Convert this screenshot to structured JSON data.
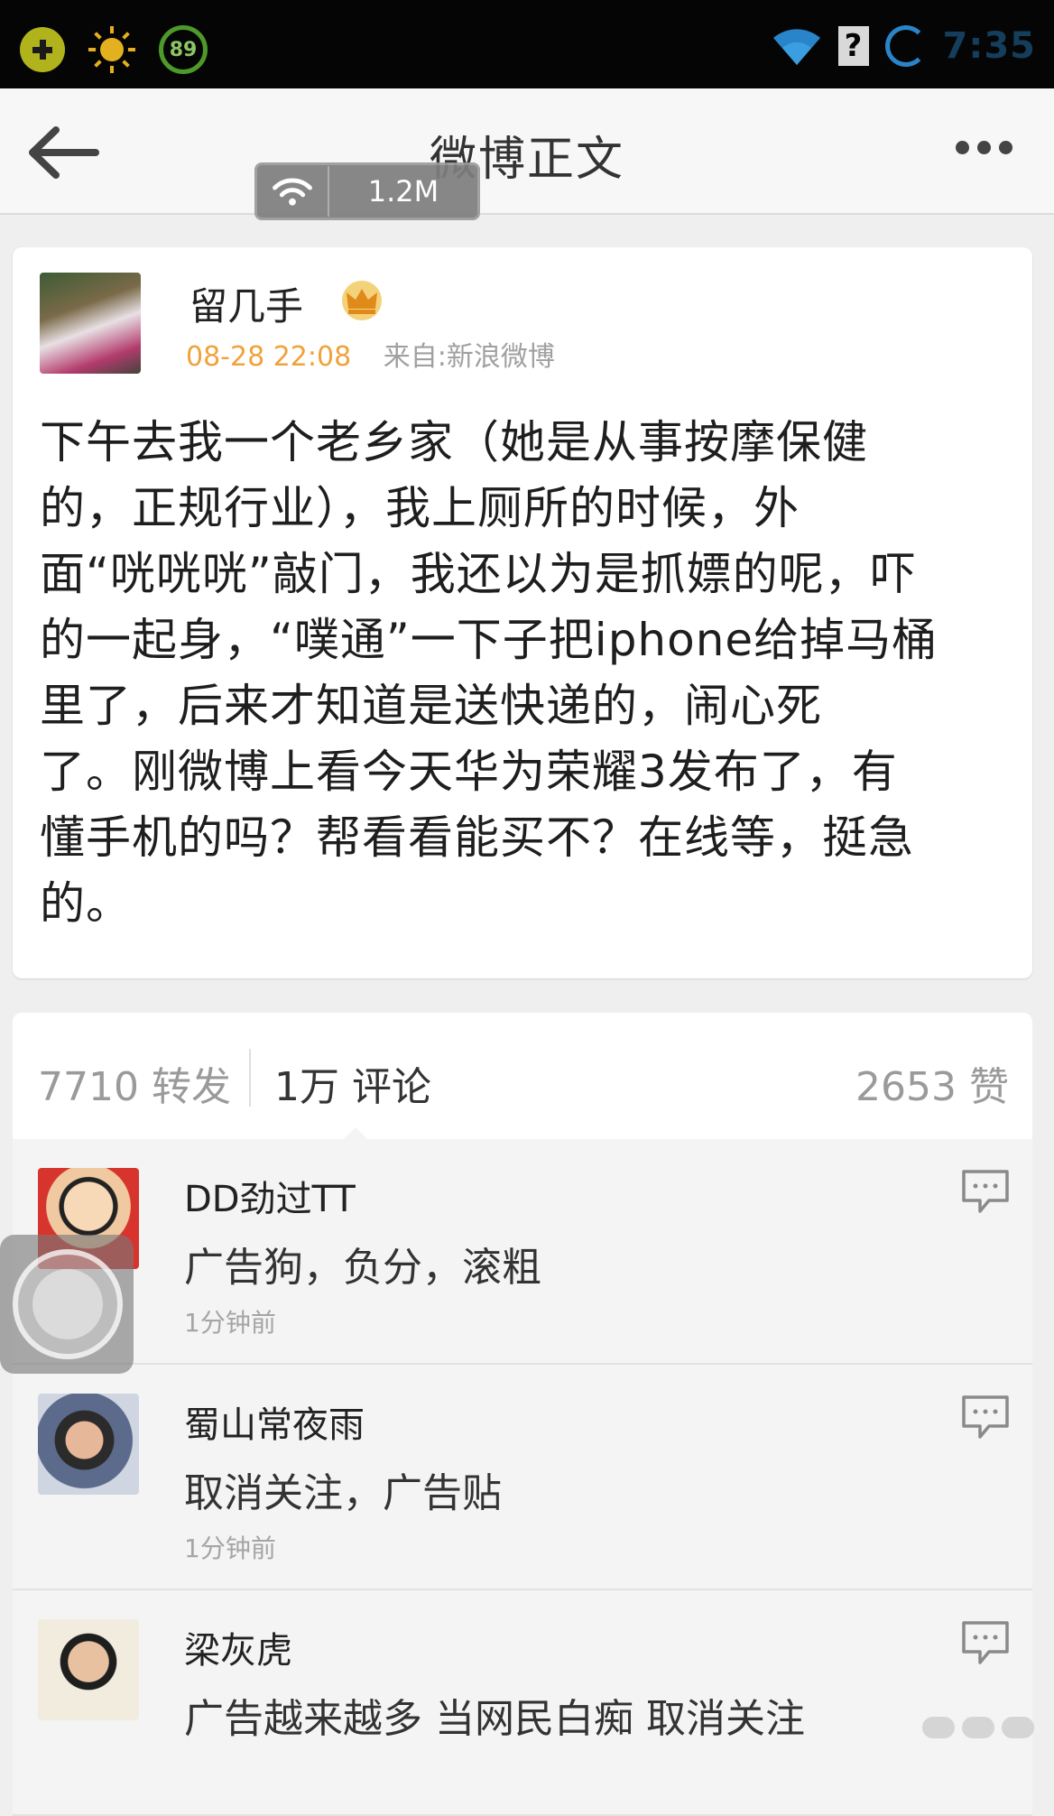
{
  "status_bar": {
    "battery": "89",
    "time": "7:35",
    "icons": [
      "app-plus-icon",
      "sun-icon",
      "battery-ring-icon",
      "wifi-icon",
      "sim-unknown-icon",
      "sync-icon"
    ]
  },
  "header": {
    "title": "微博正文",
    "back_icon": "arrow-left-icon",
    "more_icon": "more-dots-icon"
  },
  "network_badge": {
    "speed": "1.2M"
  },
  "post": {
    "author": "留几手",
    "badge_icon": "crown-icon",
    "time": "08-28 22:08",
    "source": "来自:新浪微博",
    "lines": [
      "下午去我一个老乡家（她是从事按摩保健",
      "的，正规行业），我上厕所的时候，外",
      "面“咣咣咣”敲门，我还以为是抓嫖的呢，吓",
      "的一起身，“噗通”一下子把iphone给掉马桶",
      "里了，后来才知道是送快递的，闹心死",
      "了。刚微博上看今天华为荣耀3发布了，有",
      "懂手机的吗？帮看看能买不？在线等，挺急",
      "的。"
    ]
  },
  "stats": {
    "reposts": "7710 转发",
    "comments": "1万 评论",
    "likes": "2653 赞"
  },
  "comments": [
    {
      "name": "DD劲过TT",
      "text": "广告狗，负分，滚粗",
      "time": "1分钟前"
    },
    {
      "name": "蜀山常夜雨",
      "text": "取消关注，广告贴",
      "time": "1分钟前"
    },
    {
      "name": "梁灰虎",
      "text": "广告越来越多 当网民白痴 取消关注",
      "time": ""
    }
  ],
  "colors": {
    "time_accent": "#f0a23b",
    "muted": "#a0a0a0",
    "status_blue": "#2a84c9"
  }
}
